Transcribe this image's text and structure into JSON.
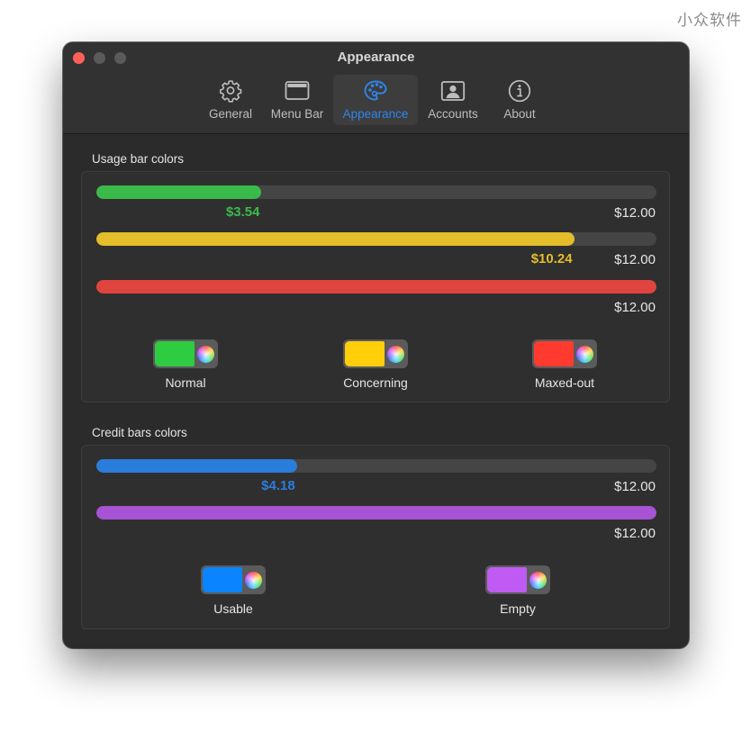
{
  "watermark": "小众软件",
  "window": {
    "title": "Appearance",
    "traffic_lights": [
      "close",
      "minimize",
      "maximize"
    ]
  },
  "toolbar": {
    "tabs": [
      {
        "label": "General",
        "icon": "gear-icon",
        "active": false
      },
      {
        "label": "Menu Bar",
        "icon": "menu-bar-icon",
        "active": false
      },
      {
        "label": "Appearance",
        "icon": "palette-icon",
        "active": true
      },
      {
        "label": "Accounts",
        "icon": "person-card-icon",
        "active": false
      },
      {
        "label": "About",
        "icon": "info-icon",
        "active": false
      }
    ]
  },
  "usage": {
    "title": "Usage bar colors",
    "bars": [
      {
        "value_label": "$3.54",
        "max_label": "$12.00",
        "fraction": 0.295,
        "color": "#3bba4c"
      },
      {
        "value_label": "$10.24",
        "max_label": "$12.00",
        "fraction": 0.853,
        "color": "#e3bd2a"
      },
      {
        "value_label": "",
        "max_label": "$12.00",
        "fraction": 1.0,
        "color": "#e0443e"
      }
    ],
    "swatches": [
      {
        "label": "Normal",
        "color": "#2ecc40"
      },
      {
        "label": "Concerning",
        "color": "#ffcf0a"
      },
      {
        "label": "Maxed-out",
        "color": "#ff3b30"
      }
    ],
    "value_colors": [
      "#3bba4c",
      "#e3bd2a"
    ]
  },
  "credit": {
    "title": "Credit bars colors",
    "bars": [
      {
        "value_label": "$4.18",
        "max_label": "$12.00",
        "fraction": 0.358,
        "color": "#2a7ddb"
      },
      {
        "value_label": "",
        "max_label": "$12.00",
        "fraction": 1.0,
        "color": "#a753d4"
      }
    ],
    "swatches": [
      {
        "label": "Usable",
        "color": "#0a84ff"
      },
      {
        "label": "Empty",
        "color": "#bf5af2"
      }
    ],
    "value_colors": [
      "#2a7ddb"
    ]
  }
}
